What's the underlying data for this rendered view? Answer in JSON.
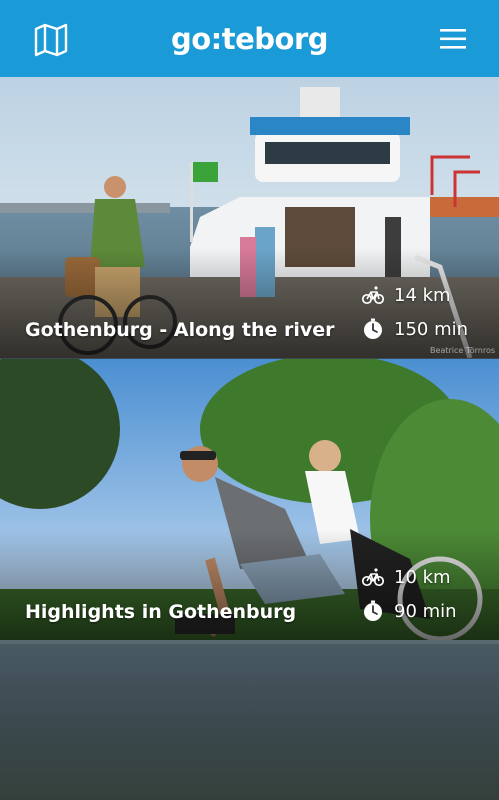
{
  "header": {
    "logo_text": "go:teborg",
    "map_icon": "map-icon",
    "menu_icon": "hamburger-menu-icon"
  },
  "colors": {
    "header_bg": "#1a9ad6",
    "text": "#ffffff"
  },
  "routes": [
    {
      "title": "Gothenburg - Along the river",
      "distance": "14 km",
      "duration": "150 min",
      "photo_credit": "Beatrice Törnros"
    },
    {
      "title": "Highlights in Gothenburg",
      "distance": "10 km",
      "duration": "90 min"
    }
  ]
}
